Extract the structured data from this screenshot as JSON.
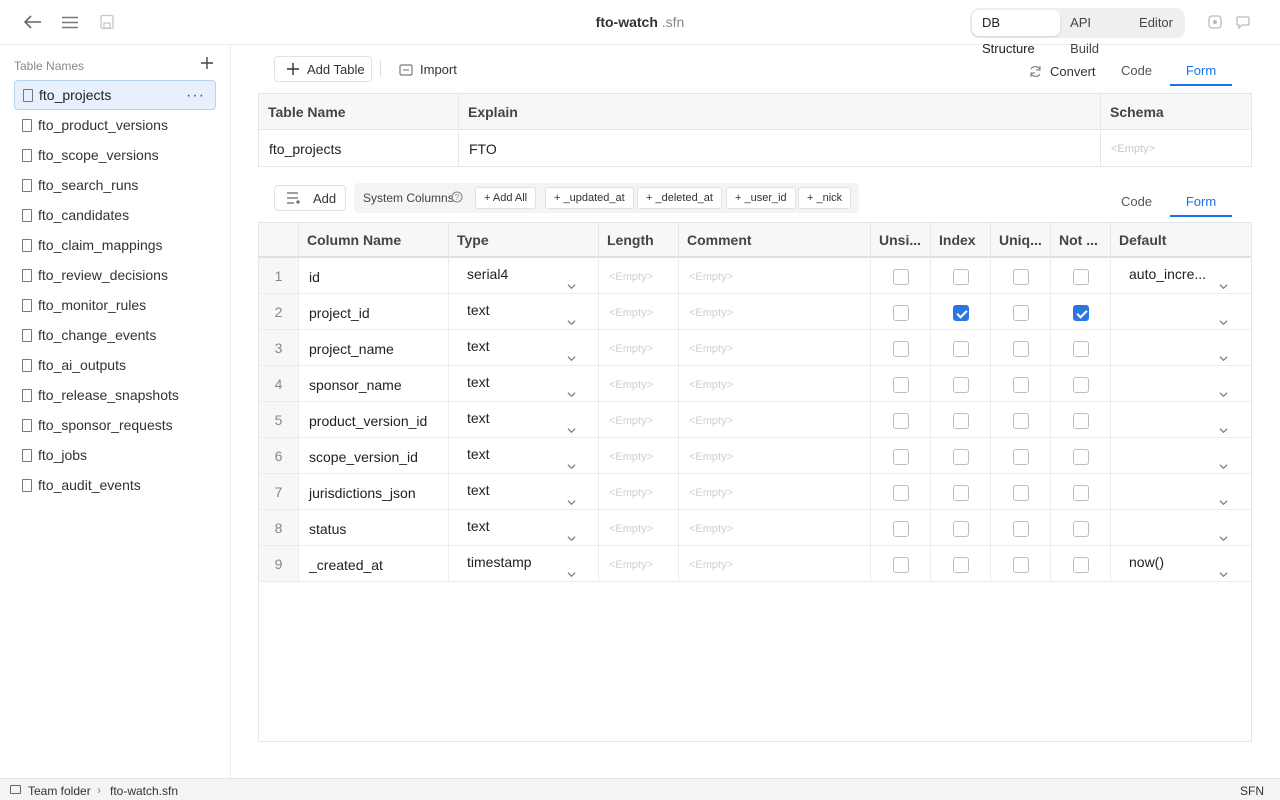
{
  "window": {
    "title_name": "fto-watch",
    "title_ext": ".sfn"
  },
  "view_tabs": [
    "DB Structure",
    "API Build",
    "Editor"
  ],
  "sidebar": {
    "header": "Table Names",
    "items": [
      "fto_projects",
      "fto_product_versions",
      "fto_scope_versions",
      "fto_search_runs",
      "fto_candidates",
      "fto_claim_mappings",
      "fto_review_decisions",
      "fto_monitor_rules",
      "fto_change_events",
      "fto_ai_outputs",
      "fto_release_snapshots",
      "fto_sponsor_requests",
      "fto_jobs",
      "fto_audit_events"
    ],
    "more": "···"
  },
  "table_toolbar": {
    "add_table": "Add Table",
    "import": "Import",
    "convert": "Convert",
    "code_tab": "Code",
    "form_tab": "Form"
  },
  "table_info": {
    "headers": {
      "name": "Table Name",
      "explain": "Explain",
      "schema": "Schema"
    },
    "name": "fto_projects",
    "explain": "FTO",
    "schema_placeholder": "<Empty>"
  },
  "columns_toolbar": {
    "add": "Add",
    "system_columns": "System Columns",
    "chips": [
      "+ Add All",
      "+ _updated_at",
      "+ _deleted_at",
      "+ _user_id",
      "+ _nick"
    ],
    "code_tab": "Code",
    "form_tab": "Form"
  },
  "columns": {
    "headers": {
      "name": "Column Name",
      "type": "Type",
      "length": "Length",
      "comment": "Comment",
      "unsigned": "Unsi...",
      "index": "Index",
      "unique": "Uniq...",
      "not_null": "Not ...",
      "default": "Default"
    },
    "placeholder": "<Empty>",
    "rows": [
      {
        "num": "1",
        "name": "id",
        "type": "serial4",
        "unsigned": false,
        "index": false,
        "unique": false,
        "not_null": false,
        "default": "auto_incre..."
      },
      {
        "num": "2",
        "name": "project_id",
        "type": "text",
        "unsigned": false,
        "index": true,
        "unique": false,
        "not_null": true,
        "default": ""
      },
      {
        "num": "3",
        "name": "project_name",
        "type": "text",
        "unsigned": false,
        "index": false,
        "unique": false,
        "not_null": false,
        "default": ""
      },
      {
        "num": "4",
        "name": "sponsor_name",
        "type": "text",
        "unsigned": false,
        "index": false,
        "unique": false,
        "not_null": false,
        "default": ""
      },
      {
        "num": "5",
        "name": "product_version_id",
        "type": "text",
        "unsigned": false,
        "index": false,
        "unique": false,
        "not_null": false,
        "default": ""
      },
      {
        "num": "6",
        "name": "scope_version_id",
        "type": "text",
        "unsigned": false,
        "index": false,
        "unique": false,
        "not_null": false,
        "default": ""
      },
      {
        "num": "7",
        "name": "jurisdictions_json",
        "type": "text",
        "unsigned": false,
        "index": false,
        "unique": false,
        "not_null": false,
        "default": ""
      },
      {
        "num": "8",
        "name": "status",
        "type": "text",
        "unsigned": false,
        "index": false,
        "unique": false,
        "not_null": false,
        "default": ""
      },
      {
        "num": "9",
        "name": "_created_at",
        "type": "timestamp",
        "unsigned": false,
        "index": false,
        "unique": false,
        "not_null": false,
        "default": "now()"
      }
    ]
  },
  "status_bar": {
    "folder": "Team folder",
    "file": "fto-watch.sfn",
    "lang": "SFN"
  },
  "colors": {
    "accent": "#1a73e8",
    "checkbox_on": "#2b76e5",
    "selected_bg": "#e7f0fc"
  }
}
